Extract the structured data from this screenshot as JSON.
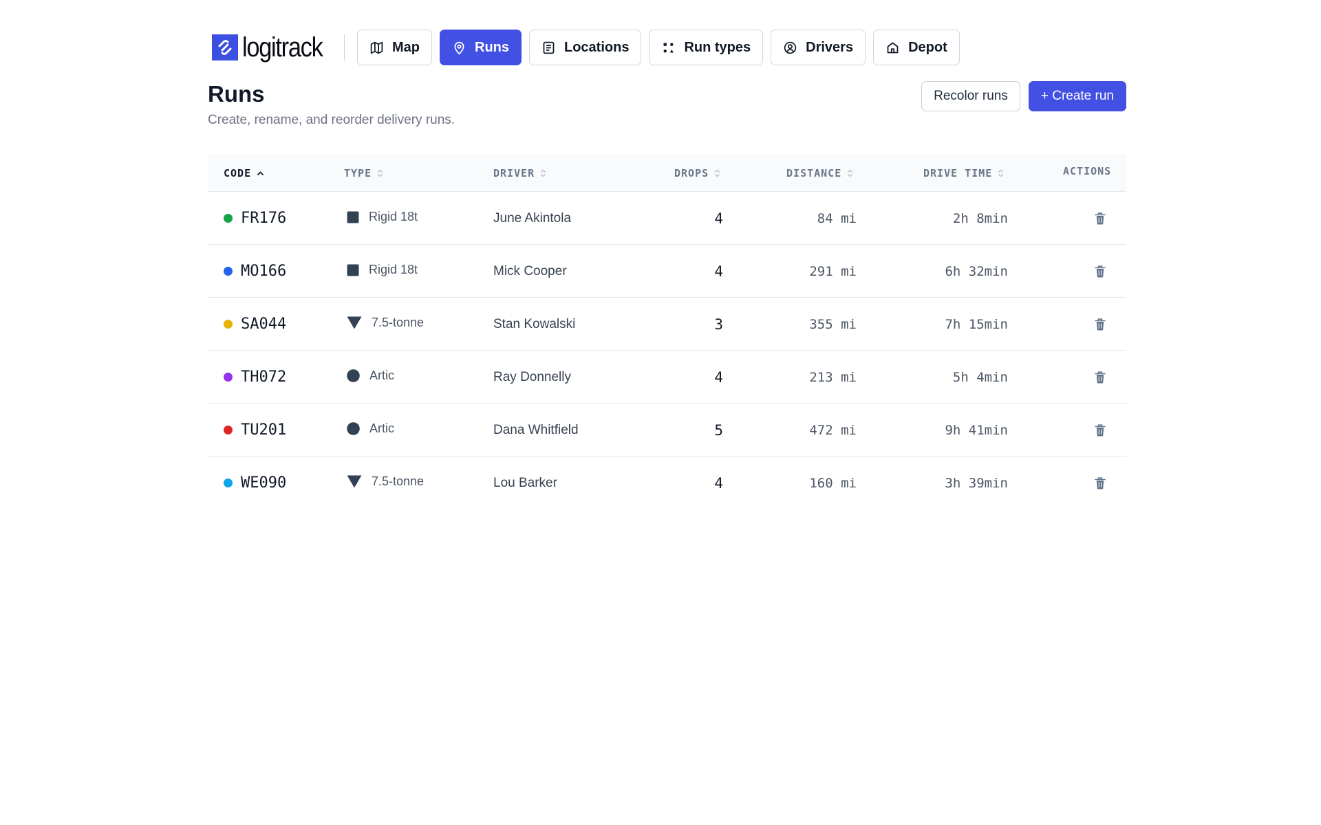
{
  "brand": {
    "name": "logitrack",
    "color": "#3b4fe0"
  },
  "nav": [
    {
      "label": "Map",
      "icon": "map-icon",
      "active": false
    },
    {
      "label": "Runs",
      "icon": "pin-icon",
      "active": true
    },
    {
      "label": "Locations",
      "icon": "list-icon",
      "active": false
    },
    {
      "label": "Run types",
      "icon": "shapes-icon",
      "active": false
    },
    {
      "label": "Drivers",
      "icon": "user-circle-icon",
      "active": false
    },
    {
      "label": "Depot",
      "icon": "home-icon",
      "active": false
    }
  ],
  "header": {
    "title": "Runs",
    "subtitle": "Create, rename, and reorder delivery runs.",
    "recolor_label": "Recolor runs",
    "create_label": "+ Create run"
  },
  "table": {
    "columns": {
      "code": "CODE",
      "type": "TYPE",
      "driver": "DRIVER",
      "drops": "DROPS",
      "distance": "DISTANCE",
      "drive_time": "DRIVE TIME",
      "actions": "ACTIONS"
    },
    "sorted_by": "code",
    "sort_direction": "ascending",
    "rows": [
      {
        "code": "FR176",
        "color": "#16a34a",
        "type": "Rigid 18t",
        "type_shape": "square",
        "driver": "June Akintola",
        "drops": "4",
        "distance": "84 mi",
        "drive_time": "2h 8min"
      },
      {
        "code": "MO166",
        "color": "#2563eb",
        "type": "Rigid 18t",
        "type_shape": "square",
        "driver": "Mick Cooper",
        "drops": "4",
        "distance": "291 mi",
        "drive_time": "6h 32min"
      },
      {
        "code": "SA044",
        "color": "#eab308",
        "type": "7.5-tonne",
        "type_shape": "triangle",
        "driver": "Stan Kowalski",
        "drops": "3",
        "distance": "355 mi",
        "drive_time": "7h 15min"
      },
      {
        "code": "TH072",
        "color": "#9333ea",
        "type": "Artic",
        "type_shape": "circle",
        "driver": "Ray Donnelly",
        "drops": "4",
        "distance": "213 mi",
        "drive_time": "5h 4min"
      },
      {
        "code": "TU201",
        "color": "#dc2626",
        "type": "Artic",
        "type_shape": "circle",
        "driver": "Dana Whitfield",
        "drops": "5",
        "distance": "472 mi",
        "drive_time": "9h 41min"
      },
      {
        "code": "WE090",
        "color": "#0ea5e9",
        "type": "7.5-tonne",
        "type_shape": "triangle",
        "driver": "Lou Barker",
        "drops": "4",
        "distance": "160 mi",
        "drive_time": "3h 39min"
      }
    ]
  }
}
